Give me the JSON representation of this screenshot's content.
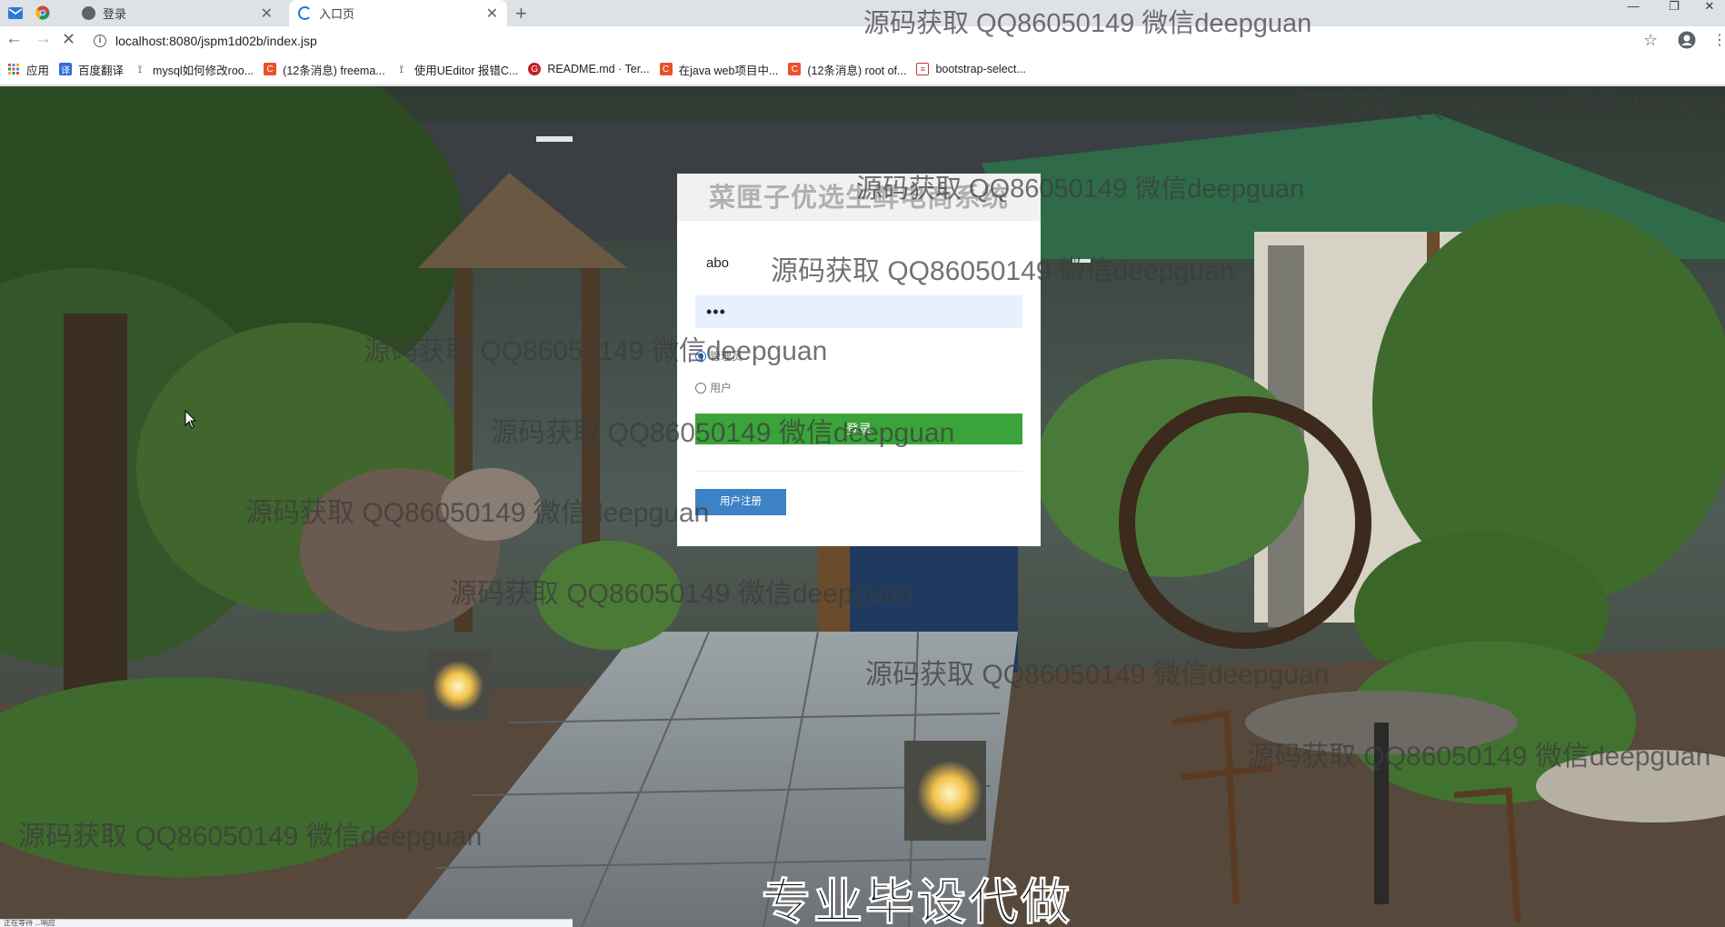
{
  "browser": {
    "tabs": [
      {
        "label": "登录",
        "active": false
      },
      {
        "label": "入口页",
        "active": true
      }
    ],
    "address": "localhost:8080/jspm1d02b/index.jsp",
    "bookmarks": [
      {
        "label": "应用",
        "icon": "apps-icon"
      },
      {
        "label": "百度翻译",
        "icon": "baidu-translate-icon"
      },
      {
        "label": "mysql如何修改roo...",
        "icon": "mysql-icon"
      },
      {
        "label": "(12条消息) freema...",
        "icon": "csdn-icon"
      },
      {
        "label": "使用UEditor 报错C...",
        "icon": "mysql-icon"
      },
      {
        "label": "README.md · Ter...",
        "icon": "gitee-icon"
      },
      {
        "label": "在java web项目中...",
        "icon": "csdn-icon"
      },
      {
        "label": "(12条消息) root of...",
        "icon": "csdn-icon"
      },
      {
        "label": "bootstrap-select...",
        "icon": "bookmark-icon"
      }
    ],
    "status": "正在等待 ...响应"
  },
  "login": {
    "title": "菜匣子优选生鲜电商系统",
    "username": "abo",
    "password": "•••",
    "roles": [
      {
        "label": "管理员",
        "checked": true
      },
      {
        "label": "用户",
        "checked": false
      }
    ],
    "login_button": "登录",
    "register_button": "用户注册"
  },
  "watermark": "源码获取 QQ86050149 微信deepguan",
  "caption": "专业毕设代做",
  "colors": {
    "login_green": "#3aa43a",
    "register_blue": "#3d82c4",
    "autofill_blue": "#e8f0fe"
  }
}
